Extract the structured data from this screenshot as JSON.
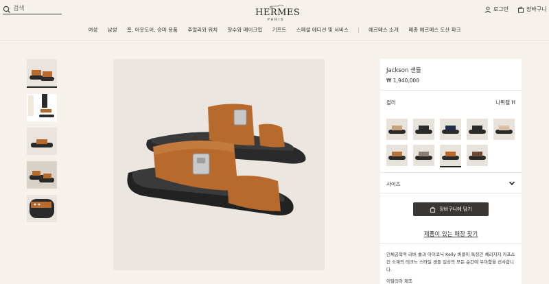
{
  "header": {
    "search_placeholder": "검색",
    "logo_brand": "HERMES",
    "logo_city": "PARIS",
    "login": "로그인",
    "cart": "장바구니"
  },
  "nav": {
    "items": [
      "여성",
      "남성",
      "홈, 아웃도어, 승마 용품",
      "주얼리와 워치",
      "향수와 메이크업",
      "기프트",
      "스페셜 에디션 및 서비스",
      "에르메스 소개",
      "메종 에르메스 도산 파크"
    ]
  },
  "product": {
    "name": "Jackson 샌들",
    "price": "₩ 1,940,000",
    "color_label": "컬러",
    "color_value": "나뛰렐 H",
    "size_label": "사이즈",
    "add_to_cart": "장바구니에 담기",
    "store_link": "제품이 있는 매장 찾기",
    "description": "인체공학적 러버 솔과 아이코닉 Kelly 버클이 특징인 체리지지 카프스킨 소재의 테크노 스타일 샌들 일상의 모든 순간에 우아함을 선사합니다.",
    "origin": "이탈리아 제조"
  },
  "swatch_colors": [
    "#c8a27a",
    "#2b2b2b",
    "#1f2f4a",
    "#2a2a2a",
    "#d8c2a3",
    "#b5763e",
    "#8a7f70",
    "#b86a2c",
    "#6e4a36"
  ],
  "colors": {
    "accent_dark": "#3a3634",
    "background": "#f6f1eb",
    "panel": "#ffffff",
    "sandal_leather": "#b86a2c",
    "sole": "#2a2a2a"
  }
}
